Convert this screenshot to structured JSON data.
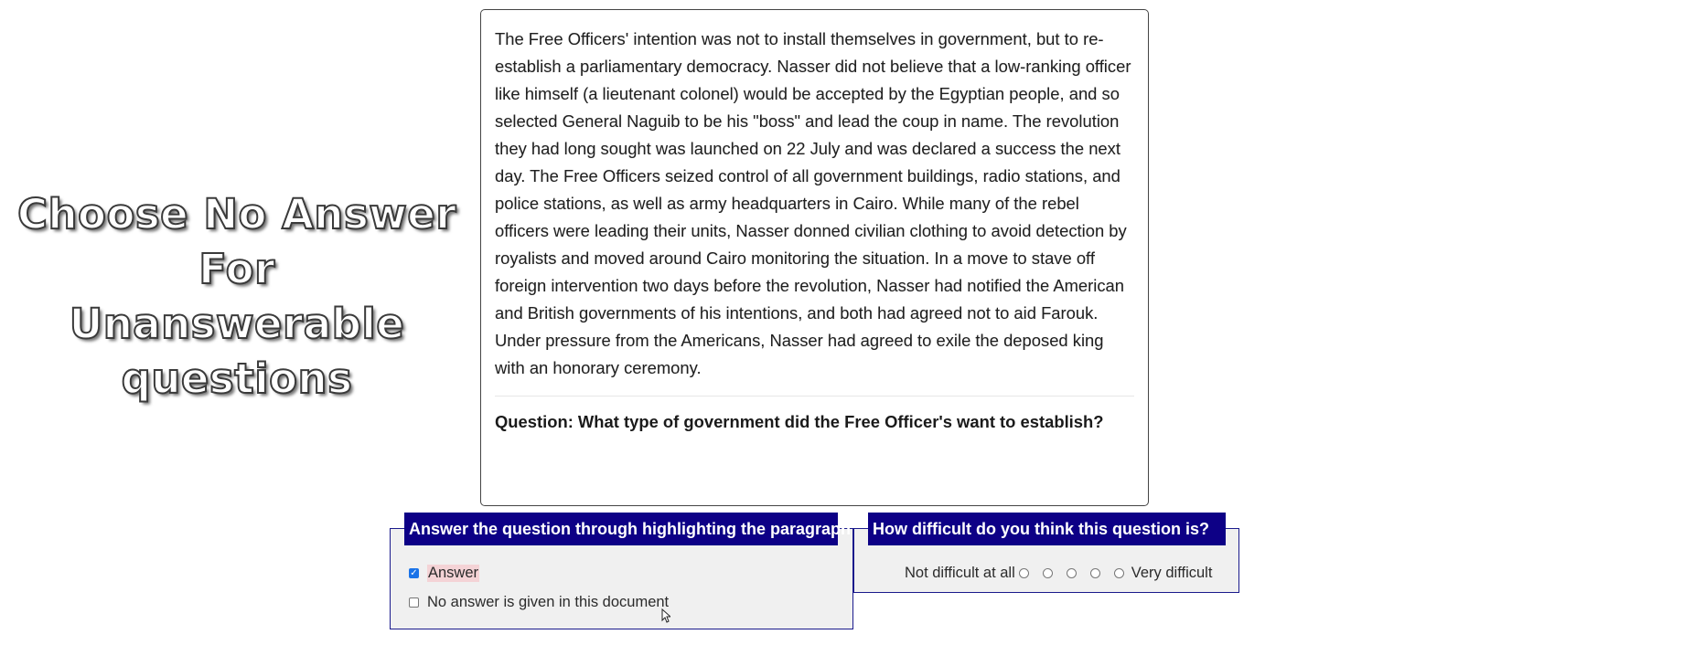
{
  "banner": {
    "lines": [
      "Choose No Answer",
      "For",
      "Unanswerable",
      "questions"
    ]
  },
  "passage": {
    "text": "The Free Officers' intention was not to install themselves in government, but to re-establish a parliamentary democracy. Nasser did not believe that a low-ranking officer like himself (a lieutenant colonel) would be accepted by the Egyptian people, and so selected General Naguib to be his \"boss\" and lead the coup in name. The revolution they had long sought was launched on 22 July and was declared a success the next day. The Free Officers seized control of all government buildings, radio stations, and police stations, as well as army headquarters in Cairo. While many of the rebel officers were leading their units, Nasser donned civilian clothing to avoid detection by royalists and moved around Cairo monitoring the situation. In a move to stave off foreign intervention two days before the revolution, Nasser had notified the American and British governments of his intentions, and both had agreed not to aid Farouk. Under pressure from the Americans, Nasser had agreed to exile the deposed king with an honorary ceremony.",
    "question": "Question: What type of government did the Free Officer's want to establish?"
  },
  "answer_panel": {
    "legend": "Answer the question through highlighting the paragraph",
    "options": [
      {
        "label": "Answer",
        "checked": true
      },
      {
        "label": "No answer is given in this document",
        "checked": false
      }
    ]
  },
  "difficulty_panel": {
    "legend": "How difficult do you think this question is?",
    "min_label": "Not difficult at all",
    "max_label": "Very difficult",
    "scale_points": 5,
    "selected": null
  },
  "colors": {
    "legend_bg": "#0d0086",
    "highlight": "#f4d3d6",
    "panel_bg": "#f0f0f0"
  }
}
